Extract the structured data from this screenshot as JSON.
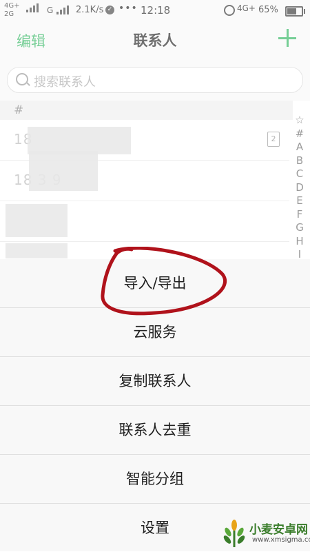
{
  "status_bar": {
    "network_1": "4G+",
    "network_2": "2G",
    "network_3": "G",
    "speed": "2.1K/s",
    "dots": "•••",
    "time": "12:18",
    "network_right": "4G+",
    "battery_pct": "65%"
  },
  "nav": {
    "edit_label": "编辑",
    "title": "联系人"
  },
  "search": {
    "placeholder": "搜索联系人"
  },
  "contacts": {
    "section_header": "#",
    "rows": [
      {
        "number": "18",
        "sim_badge": "2"
      },
      {
        "number": "18           3 9"
      }
    ]
  },
  "index": [
    "☆",
    "#",
    "A",
    "B",
    "C",
    "D",
    "E",
    "F",
    "G",
    "H",
    "I"
  ],
  "sheet": {
    "items": [
      "导入/导出",
      "云服务",
      "复制联系人",
      "联系人去重",
      "智能分组",
      "设置"
    ]
  },
  "watermark": {
    "title": "小麦安卓网",
    "url": "www.xmsigma.com"
  },
  "colors": {
    "accent": "#2bb45c",
    "annotation": "#b0121b"
  }
}
